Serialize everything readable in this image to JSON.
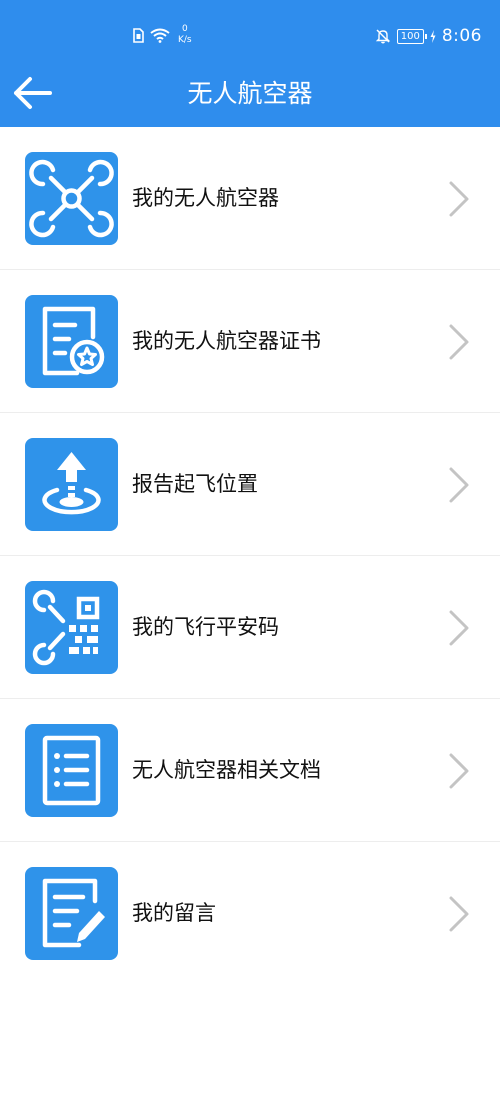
{
  "status_bar": {
    "net_speed_value": "0",
    "net_speed_unit": "K/s",
    "battery": "100",
    "time": "8:06"
  },
  "header": {
    "title": "无人航空器"
  },
  "menu": [
    {
      "label": "我的无人航空器",
      "icon": "drone-icon"
    },
    {
      "label": "我的无人航空器证书",
      "icon": "certificate-icon"
    },
    {
      "label": "报告起飞位置",
      "icon": "takeoff-location-icon"
    },
    {
      "label": "我的飞行平安码",
      "icon": "qr-code-icon"
    },
    {
      "label": "无人航空器相关文档",
      "icon": "document-list-icon"
    },
    {
      "label": "我的留言",
      "icon": "message-edit-icon"
    }
  ],
  "colors": {
    "header_bg": "#2f8ded",
    "icon_bg": "#2f93ea",
    "chevron": "#c4c4c4",
    "divider": "#ededed"
  }
}
